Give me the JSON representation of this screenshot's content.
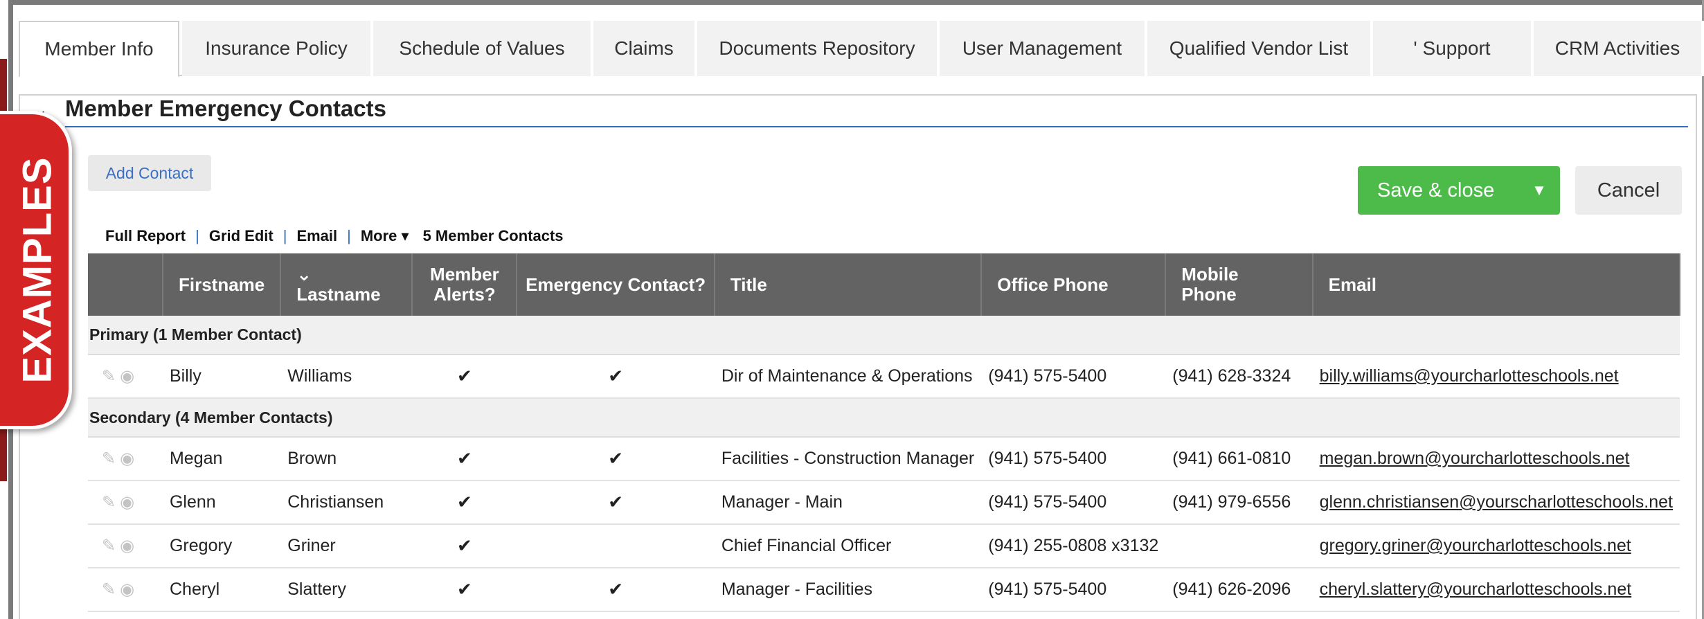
{
  "badge": "EXAMPLES",
  "tabs": [
    "Member Info",
    "Insurance Policy",
    "Schedule of Values",
    "Claims",
    "Documents Repository",
    "User Management",
    "Qualified Vendor List",
    "' Support",
    "CRM Activities"
  ],
  "section": {
    "title": "Member Emergency Contacts"
  },
  "buttons": {
    "add_contact": "Add Contact",
    "save_close": "Save & close",
    "cancel": "Cancel"
  },
  "actions": {
    "full_report": "Full Report",
    "grid_edit": "Grid Edit",
    "email": "Email",
    "more": "More ▾",
    "count": "5 Member Contacts",
    "separator": "|"
  },
  "table": {
    "headers": {
      "firstname": "Firstname",
      "lastname": "⌄ Lastname",
      "alerts": "Member Alerts?",
      "emergency": "Emergency Contact?",
      "title": "Title",
      "office": "Office Phone",
      "mobile": "Mobile Phone",
      "email": "Email"
    },
    "groups": [
      {
        "label": "Primary (1 Member Contact)",
        "rows": [
          {
            "first": "Billy",
            "last": "Williams",
            "alerts": "✔",
            "emergency": "✔",
            "title": "Dir of Maintenance & Operations",
            "office": "(941) 575-5400",
            "mobile": "(941) 628-3324",
            "email": "billy.williams@yourcharlotteschools.net"
          }
        ]
      },
      {
        "label": "Secondary (4 Member Contacts)",
        "rows": [
          {
            "first": "Megan",
            "last": "Brown",
            "alerts": "✔",
            "emergency": "✔",
            "title": "Facilities - Construction Manager",
            "office": "(941) 575-5400",
            "mobile": "(941) 661-0810",
            "email": "megan.brown@yourcharlotteschools.net"
          },
          {
            "first": "Glenn",
            "last": "Christiansen",
            "alerts": "✔",
            "emergency": "✔",
            "title": "Manager - Main",
            "office": "(941) 575-5400",
            "mobile": "(941) 979-6556",
            "email": "glenn.christiansen@yourscharlotteschools.net"
          },
          {
            "first": "Gregory",
            "last": "Griner",
            "alerts": "✔",
            "emergency": "",
            "title": "Chief Financial Officer",
            "office": "(941) 255-0808 x3132",
            "mobile": "",
            "email": "gregory.griner@yourcharlotteschools.net"
          },
          {
            "first": "Cheryl",
            "last": "Slattery",
            "alerts": "✔",
            "emergency": "✔",
            "title": "Manager - Facilities",
            "office": "(941) 575-5400",
            "mobile": "(941) 626-2096",
            "email": "cheryl.slattery@yourcharlotteschools.net"
          }
        ]
      }
    ]
  },
  "icons": {
    "edit": "pencil-icon",
    "view": "eye-icon",
    "collapse": "chevron-down-icon",
    "save_menu": "caret-down-icon"
  },
  "colors": {
    "save": "#4cbb4a",
    "header": "#636363",
    "badge": "#d42424",
    "link": "#3a6fc4",
    "rule": "#2e6fbf"
  }
}
